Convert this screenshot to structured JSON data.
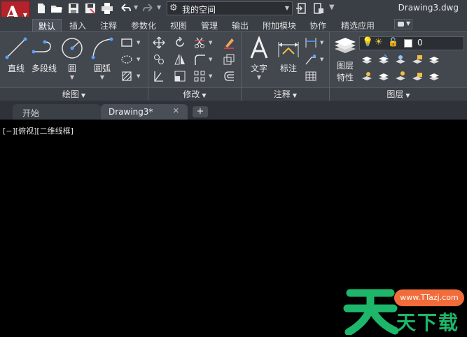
{
  "titlebar": {
    "app_letter": "A",
    "workspace": "我的空间",
    "doc_title": "Drawing3.dwg"
  },
  "ribbon_tabs": [
    "默认",
    "插入",
    "注释",
    "参数化",
    "视图",
    "管理",
    "输出",
    "附加模块",
    "协作",
    "精选应用"
  ],
  "panels": {
    "draw": {
      "footer": "绘图",
      "tools": [
        "直线",
        "多段线",
        "圆",
        "圆弧"
      ]
    },
    "modify": {
      "footer": "修改"
    },
    "annotation": {
      "footer": "注释",
      "tools": [
        "文字",
        "标注"
      ]
    },
    "layers": {
      "footer": "图层",
      "prop_label_1": "图层",
      "prop_label_2": "特性",
      "layer_value": "0"
    }
  },
  "doc_tabs": {
    "start": "开始",
    "drawing": "Drawing3*",
    "close": "✕",
    "add": "+"
  },
  "canvas": {
    "view_label": "[−][俯视][二维线框]"
  },
  "watermark": {
    "url": "www.TTazj.com",
    "text": "天下载"
  },
  "colors": {
    "app_red": "#b4232a",
    "ribbon_bg": "#43474e",
    "watermark_green": "#1db66a",
    "watermark_orange": "#f26b3a"
  }
}
